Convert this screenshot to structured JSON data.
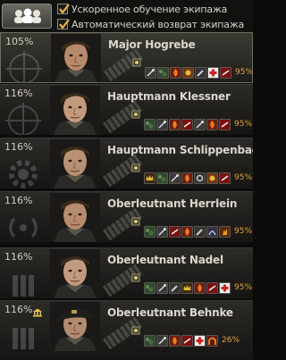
{
  "options": {
    "accelerated": "Ускоренное обучение экипажа",
    "auto_return": "Автоматический возврат экипажа"
  },
  "crew": [
    {
      "percent": "105%",
      "name": "Major Hogrebe",
      "skill_progress": "95%",
      "skills": [
        "repair",
        "camo",
        "firefight",
        "sixth-sense",
        "wrench",
        "cross",
        "gun"
      ],
      "accent": "#c33"
    },
    {
      "percent": "116%",
      "name": "Hauptmann Klessner",
      "skill_progress": "95%",
      "skills": [
        "camo",
        "repair",
        "firefight",
        "gun",
        "repair",
        "firefight",
        "gun"
      ],
      "accent": "#c33"
    },
    {
      "percent": "116%",
      "name": "Hauptmann Schlippenbach",
      "skill_progress": "95%",
      "skills": [
        "crown",
        "camo",
        "repair",
        "firefight",
        "gear",
        "sixth-sense",
        "gun"
      ],
      "accent": "#c33"
    },
    {
      "percent": "116%",
      "name": "Oberleutnant Herrlein",
      "skill_progress": "95%",
      "skills": [
        "camo",
        "repair",
        "gun",
        "firefight",
        "wrench",
        "radio",
        "fire"
      ],
      "accent": "#c33"
    },
    {
      "percent": "116%",
      "name": "Oberleutnant Nadel",
      "skill_progress": "95%",
      "skills": [
        "camo",
        "repair",
        "wrench",
        "crown",
        "firefight",
        "gun",
        "cross"
      ],
      "accent": "#c33"
    },
    {
      "percent": "116%",
      "name": "Oberleutnant Behnke",
      "skill_progress": "26%",
      "skills": [
        "camo",
        "repair",
        "firefight",
        "gun",
        "cross",
        "arch"
      ],
      "accent": "#c33"
    }
  ]
}
